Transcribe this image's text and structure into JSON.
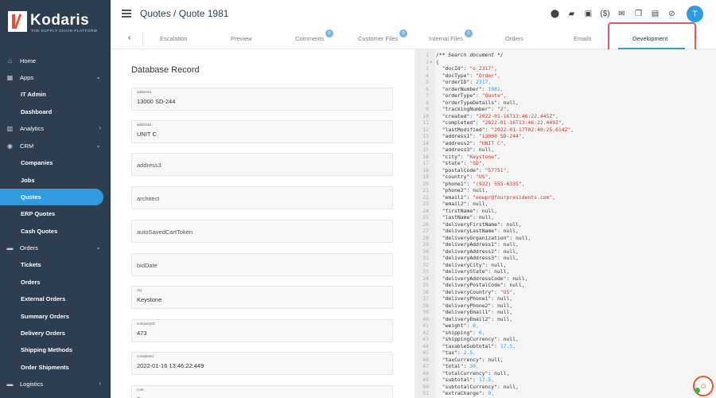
{
  "brand": {
    "name": "Kodaris",
    "tagline": "THE SUPPLY CHAIN PLATFORM"
  },
  "sidebar": {
    "items": [
      {
        "label": "Home",
        "type": "section",
        "icon": "home-icon",
        "glyph": "⌂",
        "chevron": ""
      },
      {
        "label": "Apps",
        "type": "section",
        "icon": "grid-icon",
        "glyph": "▦",
        "chevron": "⌄"
      },
      {
        "label": "IT Admin",
        "type": "sub"
      },
      {
        "label": "Dashboard",
        "type": "sub"
      },
      {
        "label": "Analytics",
        "type": "section",
        "icon": "chart-icon",
        "glyph": "▥",
        "chevron": "›"
      },
      {
        "label": "CRM",
        "type": "section",
        "icon": "crm-icon",
        "glyph": "◉",
        "chevron": "⌄"
      },
      {
        "label": "Companies",
        "type": "sub"
      },
      {
        "label": "Jobs",
        "type": "sub"
      },
      {
        "label": "Quotes",
        "type": "sub",
        "active": true
      },
      {
        "label": "ERP Quotes",
        "type": "sub"
      },
      {
        "label": "Cash Quotes",
        "type": "sub"
      },
      {
        "label": "Orders",
        "type": "section",
        "icon": "truck-icon",
        "glyph": "▬",
        "chevron": "⌄"
      },
      {
        "label": "Tickets",
        "type": "sub"
      },
      {
        "label": "Orders",
        "type": "sub"
      },
      {
        "label": "External Orders",
        "type": "sub"
      },
      {
        "label": "Summary Orders",
        "type": "sub"
      },
      {
        "label": "Delivery Orders",
        "type": "sub"
      },
      {
        "label": "Shipping Methods",
        "type": "sub"
      },
      {
        "label": "Order Shipments",
        "type": "sub"
      },
      {
        "label": "Logistics",
        "type": "section",
        "icon": "truck-icon",
        "glyph": "▬",
        "chevron": "›"
      }
    ]
  },
  "header": {
    "title": "Quotes / Quote 1981",
    "icons": [
      {
        "name": "location-pin-icon",
        "glyph": "⬤"
      },
      {
        "name": "truck-icon",
        "glyph": "▰"
      },
      {
        "name": "id-card-icon",
        "glyph": "▣"
      },
      {
        "name": "currency-icon",
        "glyph": "($)"
      },
      {
        "name": "mail-icon",
        "glyph": "✉"
      },
      {
        "name": "copy-icon",
        "glyph": "❐"
      },
      {
        "name": "pdf-icon",
        "glyph": "▤"
      },
      {
        "name": "attachment-icon",
        "glyph": "⊘"
      }
    ],
    "avatar": "T"
  },
  "tabs": [
    {
      "label": "Escalation",
      "badge": ""
    },
    {
      "label": "Preview",
      "badge": ""
    },
    {
      "label": "Comments",
      "badge": "0"
    },
    {
      "label": "Customer Files",
      "badge": "0"
    },
    {
      "label": "Internal Files",
      "badge": "0"
    },
    {
      "label": "Orders",
      "badge": ""
    },
    {
      "label": "Emails",
      "badge": ""
    },
    {
      "label": "Development",
      "badge": "",
      "active": true
    }
  ],
  "form": {
    "title": "Database Record",
    "fields": [
      {
        "label": "address1",
        "value": "13000 SD-244"
      },
      {
        "label": "address2",
        "value": "UNIT C"
      },
      {
        "label": "",
        "placeholder": "address3"
      },
      {
        "label": "",
        "placeholder": "architect"
      },
      {
        "label": "",
        "placeholder": "autoSavedCartToken"
      },
      {
        "label": "",
        "placeholder": "bidDate"
      },
      {
        "label": "city",
        "value": "Keystone"
      },
      {
        "label": "companyID",
        "value": "473"
      },
      {
        "label": "completed",
        "value": "2022-01-16 13:46:22:449"
      },
      {
        "label": "cost",
        "value": "0"
      }
    ]
  },
  "code": {
    "lines": [
      "/** Search document */",
      "{",
      "  \"docId\": \"o_2317\",",
      "  \"docType\": \"Order\",",
      "  \"orderID\": 2317,",
      "  \"orderNumber\": 1981,",
      "  \"orderType\": \"Quote\",",
      "  \"orderTypeDetails\": null,",
      "  \"trackingNumber\": \"2\",",
      "  \"created\": \"2022-01-16T13:46:22.445Z\",",
      "  \"completed\": \"2022-01-16T13:46:22.449Z\",",
      "  \"lastModified\": \"2022-01-17T02:40:25.614Z\",",
      "  \"address1\": \"13000 SD-244\",",
      "  \"address2\": \"UNIT C\",",
      "  \"address3\": null,",
      "  \"city\": \"Keystone\",",
      "  \"state\": \"SD\",",
      "  \"postalCode\": \"57751\",",
      "  \"country\": \"US\",",
      "  \"phone1\": \"(922) 555-6335\",",
      "  \"phone2\": null,",
      "  \"email1\": \"eowpr@fourpresidents.com\",",
      "  \"email2\": null,",
      "  \"firstName\": null,",
      "  \"lastName\": null,",
      "  \"deliveryFirstName\": null,",
      "  \"deliveryLastName\": null,",
      "  \"deliveryOrganization\": null,",
      "  \"deliveryAddress1\": null,",
      "  \"deliveryAddress2\": null,",
      "  \"deliveryAddress3\": null,",
      "  \"deliveryCity\": null,",
      "  \"deliveryState\": null,",
      "  \"deliveryAddressCode\": null,",
      "  \"deliveryPostalCode\": null,",
      "  \"deliveryCountry\": \"US\",",
      "  \"deliveryPhone1\": null,",
      "  \"deliveryPhone2\": null,",
      "  \"deliveryEmail1\": null,",
      "  \"deliveryEmail2\": null,",
      "  \"weight\": 0,",
      "  \"shipping\": 0,",
      "  \"shippingCurrency\": null,",
      "  \"taxableSubtotal\": 17.5,",
      "  \"tax\": 2.5,",
      "  \"taxCurrency\": null,",
      "  \"total\": 30,",
      "  \"totalCurrency\": null,",
      "  \"subtotal\": 17.5,",
      "  \"subtotalCurrency\": null,",
      "  \"extraCharge\": 0,"
    ]
  },
  "colors": {
    "sidebar": "#2c3e50",
    "accent": "#2f9be0",
    "highlight": "#e15b5b"
  }
}
